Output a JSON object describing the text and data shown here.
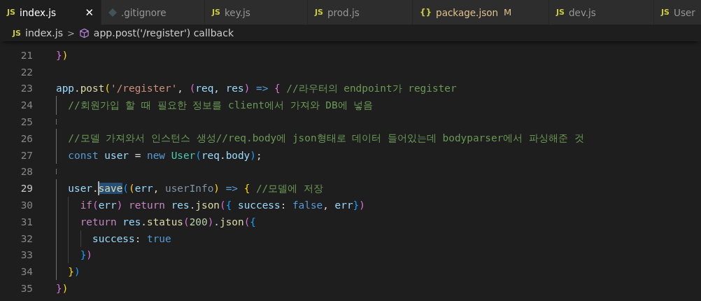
{
  "tabs": [
    {
      "kind": "js",
      "icon_text": "JS",
      "label": "index.js",
      "selected": true,
      "modified": false,
      "close_glyph": "✕"
    },
    {
      "kind": "gitignore",
      "label": ".gitignore",
      "selected": false,
      "modified": false
    },
    {
      "kind": "js",
      "icon_text": "JS",
      "label": "key.js",
      "selected": false,
      "modified": false
    },
    {
      "kind": "js",
      "icon_text": "JS",
      "label": "prod.js",
      "selected": false,
      "modified": false
    },
    {
      "kind": "json",
      "icon_text": "{}",
      "label": "package.json",
      "selected": false,
      "modified": true,
      "modified_mark": "M"
    },
    {
      "kind": "js",
      "icon_text": "JS",
      "label": "dev.js",
      "selected": false,
      "modified": false
    },
    {
      "kind": "js",
      "icon_text": "JS",
      "label": "User",
      "selected": false,
      "modified": false
    }
  ],
  "breadcrumb": {
    "file_icon_text": "JS",
    "file": "index.js",
    "separator": ">",
    "symbol": "app.post('/register') callback"
  },
  "lines": [
    {
      "number": "21",
      "active": false,
      "tokens": [
        {
          "kind": "bracket2",
          "text": "}"
        },
        {
          "kind": "bracket1",
          "text": ")"
        }
      ]
    },
    {
      "number": "22",
      "active": false
    },
    {
      "number": "23",
      "active": false,
      "tokens": [
        {
          "kind": "variable",
          "text": "app"
        },
        {
          "kind": "plain",
          "text": "."
        },
        {
          "kind": "function",
          "text": "post"
        },
        {
          "kind": "bracket1",
          "text": "("
        },
        {
          "kind": "string",
          "text": "'/register'"
        },
        {
          "kind": "plain",
          "text": ", "
        },
        {
          "kind": "bracket2",
          "text": "("
        },
        {
          "kind": "variable",
          "text": "req"
        },
        {
          "kind": "plain",
          "text": ", "
        },
        {
          "kind": "variable",
          "text": "res"
        },
        {
          "kind": "bracket2",
          "text": ")"
        },
        {
          "kind": "keyword",
          "text": " => "
        },
        {
          "kind": "bracket2",
          "text": "{"
        },
        {
          "kind": "comment",
          "text": " //라우터의 endpoint가 register"
        }
      ]
    },
    {
      "number": "24",
      "active": false,
      "tokens": [
        {
          "kind": "comment",
          "text": "  //회원가입 할 때 필요한 정보를 client에서 가져와 DB에 넣음"
        }
      ]
    },
    {
      "number": "25",
      "active": false
    },
    {
      "number": "26",
      "active": false,
      "tokens": [
        {
          "kind": "comment",
          "text": "  //모델 가져와서 인스턴스 생성//req.body에 json형태로 데이터 들어있는데 bodyparser에서 파싱해준 것"
        }
      ]
    },
    {
      "number": "27",
      "active": false,
      "tokens": [
        {
          "kind": "keyword",
          "text": "  const "
        },
        {
          "kind": "variable",
          "text": "user"
        },
        {
          "kind": "plain",
          "text": " = "
        },
        {
          "kind": "keyword",
          "text": "new "
        },
        {
          "kind": "class",
          "text": "User"
        },
        {
          "kind": "bracket3",
          "text": "("
        },
        {
          "kind": "variable",
          "text": "req"
        },
        {
          "kind": "plain",
          "text": "."
        },
        {
          "kind": "variable",
          "text": "body"
        },
        {
          "kind": "bracket3",
          "text": ")"
        },
        {
          "kind": "plain",
          "text": ";"
        }
      ]
    },
    {
      "number": "28",
      "active": false
    },
    {
      "number": "29",
      "active": true,
      "tokens": [
        {
          "kind": "variable",
          "text": "  user"
        },
        {
          "kind": "plain",
          "text": "."
        },
        {
          "kind": "function",
          "text": "save",
          "highlighted": true,
          "cursor": true
        },
        {
          "kind": "bracket3",
          "text": "("
        },
        {
          "kind": "bracket1",
          "text": "("
        },
        {
          "kind": "variable",
          "text": "err"
        },
        {
          "kind": "plain",
          "text": ", "
        },
        {
          "kind": "unused",
          "text": "userInfo"
        },
        {
          "kind": "bracket1",
          "text": ")"
        },
        {
          "kind": "keyword",
          "text": " => "
        },
        {
          "kind": "bracket1",
          "text": "{"
        },
        {
          "kind": "comment",
          "text": " //모델에 저장"
        }
      ]
    },
    {
      "number": "30",
      "active": false,
      "tokens": [
        {
          "kind": "control",
          "text": "    if"
        },
        {
          "kind": "bracket2",
          "text": "("
        },
        {
          "kind": "variable",
          "text": "err"
        },
        {
          "kind": "bracket2",
          "text": ")"
        },
        {
          "kind": "control",
          "text": " return "
        },
        {
          "kind": "variable",
          "text": "res"
        },
        {
          "kind": "plain",
          "text": "."
        },
        {
          "kind": "function",
          "text": "json"
        },
        {
          "kind": "bracket2",
          "text": "("
        },
        {
          "kind": "bracket3",
          "text": "{"
        },
        {
          "kind": "variable",
          "text": " success"
        },
        {
          "kind": "plain",
          "text": ": "
        },
        {
          "kind": "keyword",
          "text": "false"
        },
        {
          "kind": "plain",
          "text": ", "
        },
        {
          "kind": "variable",
          "text": "err"
        },
        {
          "kind": "bracket3",
          "text": "}"
        },
        {
          "kind": "bracket2",
          "text": ")"
        }
      ]
    },
    {
      "number": "31",
      "active": false,
      "tokens": [
        {
          "kind": "control",
          "text": "    return "
        },
        {
          "kind": "variable",
          "text": "res"
        },
        {
          "kind": "plain",
          "text": "."
        },
        {
          "kind": "function",
          "text": "status"
        },
        {
          "kind": "bracket2",
          "text": "("
        },
        {
          "kind": "number",
          "text": "200"
        },
        {
          "kind": "bracket2",
          "text": ")"
        },
        {
          "kind": "plain",
          "text": "."
        },
        {
          "kind": "function",
          "text": "json"
        },
        {
          "kind": "bracket2",
          "text": "("
        },
        {
          "kind": "bracket3",
          "text": "{"
        }
      ]
    },
    {
      "number": "32",
      "active": false,
      "tokens": [
        {
          "kind": "variable",
          "text": "      success"
        },
        {
          "kind": "plain",
          "text": ": "
        },
        {
          "kind": "keyword",
          "text": "true"
        }
      ]
    },
    {
      "number": "33",
      "active": false,
      "tokens": [
        {
          "kind": "bracket3",
          "text": "    }"
        },
        {
          "kind": "bracket2",
          "text": ")"
        }
      ]
    },
    {
      "number": "34",
      "active": false,
      "tokens": [
        {
          "kind": "bracket1",
          "text": "  }"
        },
        {
          "kind": "bracket3",
          "text": ")"
        }
      ]
    },
    {
      "number": "35",
      "active": false,
      "tokens": [
        {
          "kind": "bracket2",
          "text": "}"
        },
        {
          "kind": "bracket1",
          "text": ")"
        }
      ]
    }
  ]
}
